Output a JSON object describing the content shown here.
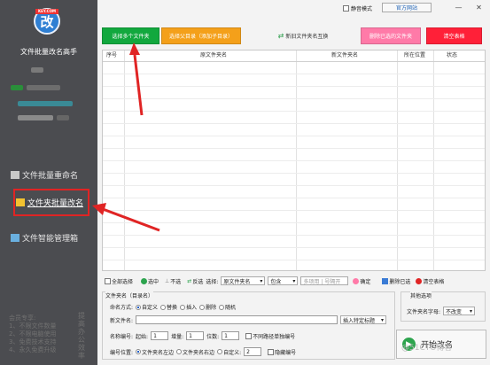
{
  "app": {
    "title": "文件批量改名高手",
    "logo_glyph": "改",
    "logo_tag": "KEY.COM"
  },
  "sidebar": {
    "items": [
      {
        "label": "文件批量重命名"
      },
      {
        "label": "文件夹批量改名"
      },
      {
        "label": "文件智能管理箱"
      }
    ],
    "promo_lines": [
      "会员专享:",
      "1、不限文件数量",
      "2、不限电脑使用",
      "3、免费技术支持",
      "4、永久免费升级"
    ],
    "vertical_text": "提高办公效率"
  },
  "top": {
    "btn_select_folders": "选择多个文件夹",
    "btn_select_subdirs": "选择父目录（添加子目录）",
    "btn_swap": "新旧文件夹名互换",
    "btn_delete_selected": "删除已选的文件夹",
    "btn_clear": "清空表格",
    "mute_label": "静音模式",
    "site_label": "官方网站"
  },
  "table": {
    "columns": [
      "序号",
      "原文件夹名",
      "新文件夹名",
      "所在位置",
      "状态"
    ]
  },
  "toolbar": {
    "select_all": "全部选择",
    "select": "选中",
    "deselect": "不选",
    "invert": "反选",
    "select_label": "选择:",
    "select_field": "原文件夹名",
    "contains": "包含",
    "search_placeholder": "多项用 | 号隔开",
    "confirm": "确定",
    "delete_selected": "删除已选",
    "clear_table": "清空表格"
  },
  "form": {
    "group_title": "文件夹名（目录名）",
    "naming_label": "命名方式:",
    "naming_options": [
      "自定义",
      "替换",
      "插入",
      "删除",
      "随机"
    ],
    "new_name_label": "新文件名:",
    "insert_btn": "插入特定标题",
    "seq_label": "名称编号:",
    "start_label": "起始:",
    "start_value": "1",
    "step_label": "增量:",
    "step_value": "1",
    "digits_label": "位数:",
    "digits_value": "1",
    "no_path_label": "不同路径单独编号",
    "pos_label": "编号位置:",
    "pos_options": [
      "文件夹名左边",
      "文件夹名右边",
      "自定义:"
    ],
    "custom_value": "2",
    "hide_label": "隐藏编号"
  },
  "other": {
    "title": "其他选项",
    "case_label": "文件夹名字母:",
    "case_value": "不改变"
  },
  "start_label": "开始改名",
  "watermark": "@51CTO博客",
  "colors": {
    "sidebar": "#4b4c50",
    "btn_green": "#12a83e",
    "btn_orange": "#f4a01a",
    "btn_pink": "#ff7aa8",
    "btn_red": "#ff2038",
    "annotation": "#e02424"
  }
}
